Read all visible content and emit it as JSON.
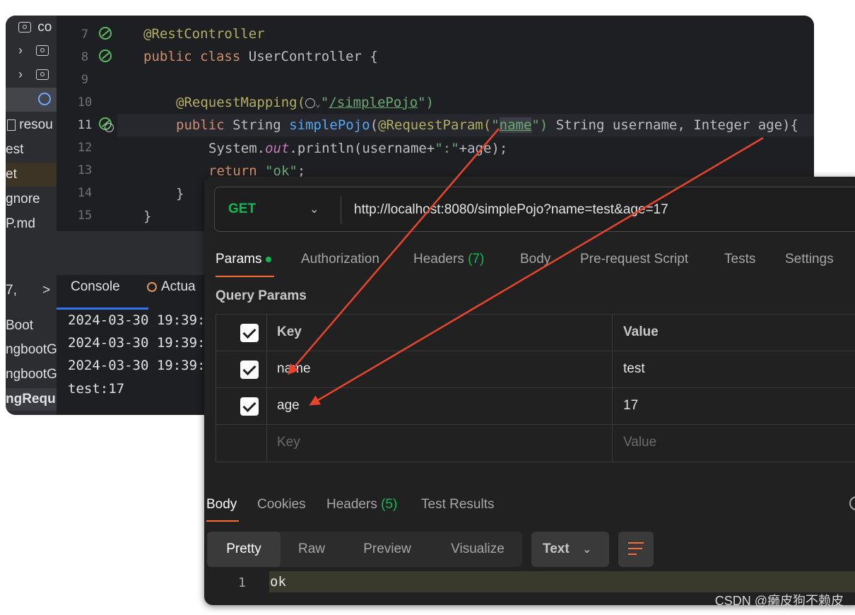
{
  "ide": {
    "project_tree": [
      {
        "label": "co",
        "type": "folder"
      },
      {
        "label": "",
        "type": "folder-collapsed"
      },
      {
        "label": "",
        "type": "folder-collapsed"
      },
      {
        "label": "",
        "type": "class-selected"
      },
      {
        "label": "resou",
        "type": "resources"
      },
      {
        "label": "est",
        "type": "file"
      },
      {
        "label": "et",
        "type": "file"
      },
      {
        "label": "gnore",
        "type": "file"
      },
      {
        "label": "P.md",
        "type": "file"
      }
    ],
    "line_numbers": [
      "7",
      "8",
      "9",
      "10",
      "11",
      "12",
      "13",
      "14",
      "15"
    ],
    "code": {
      "l7_annotation": "@RestController",
      "l8_kw1": "public",
      "l8_kw2": "class",
      "l8_rest": "UserController {",
      "l10_annotation": "@RequestMapping(",
      "l10_open_quote": "\"",
      "l10_path": "/simplePojo",
      "l10_close": "\")",
      "l11_kw": "public",
      "l11_type": "String",
      "l11_method": "simplePojo",
      "l11_paren": "(",
      "l11_annotation": "@RequestParam(",
      "l11_q1": "\"",
      "l11_param": "name",
      "l11_q2": "\")",
      "l11_rest": "String username, Integer age){",
      "l12_obj": "System.",
      "l12_field": "out",
      "l12_call": ".println(username+",
      "l12_str": "\":\"",
      "l12_end": "+age);",
      "l13_kw": "return",
      "l13_str": "\"ok\"",
      "l13_end": ";",
      "l14": "}",
      "l15": "}"
    },
    "run_tree": [
      "7,",
      "Boot",
      "ngbootG",
      "ngbootG",
      "ngRequ"
    ],
    "run_tree_chevron": ">",
    "console_tab": "Console",
    "actuator_tab": "Actua",
    "console_lines": [
      "2024-03-30 19:39:",
      "2024-03-30 19:39:",
      "2024-03-30 19:39:",
      "test:17"
    ]
  },
  "postman": {
    "method": "GET",
    "url": "http://localhost:8080/simplePojo?name=test&age=17",
    "tabs": {
      "params": "Params",
      "authorization": "Authorization",
      "headers": "Headers",
      "headers_count": "(7)",
      "body": "Body",
      "prerequest": "Pre-request Script",
      "tests": "Tests",
      "settings": "Settings"
    },
    "query_params_label": "Query Params",
    "table": {
      "header": {
        "key": "Key",
        "value": "Value"
      },
      "rows": [
        {
          "key": "name",
          "value": "test",
          "checked": true
        },
        {
          "key": "age",
          "value": "17",
          "checked": true
        }
      ],
      "placeholder": {
        "key": "Key",
        "value": "Value"
      }
    },
    "response_tabs": {
      "body": "Body",
      "cookies": "Cookies",
      "headers": "Headers",
      "headers_count": "(5)",
      "test_results": "Test Results"
    },
    "view_modes": [
      "Pretty",
      "Raw",
      "Preview",
      "Visualize"
    ],
    "format": "Text",
    "response_lines": [
      {
        "no": "1",
        "text": "ok"
      }
    ]
  },
  "watermark": "CSDN @癞皮狗不赖皮",
  "colors": {
    "annotation_arrow": "#e8452c",
    "postman_accent": "#ff6c37",
    "postman_green": "#0cbb52",
    "ide_keyword": "#cf8e6d",
    "ide_string": "#6aab73",
    "ide_annotation": "#b3ae60"
  }
}
